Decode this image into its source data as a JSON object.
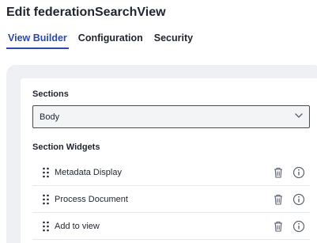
{
  "header": {
    "title": "Edit federationSearchView"
  },
  "tabs": [
    {
      "label": "View Builder",
      "active": true
    },
    {
      "label": "Configuration",
      "active": false
    },
    {
      "label": "Security",
      "active": false
    }
  ],
  "sections": {
    "label": "Sections",
    "selected": "Body"
  },
  "section_widgets": {
    "label": "Section Widgets",
    "items": [
      {
        "label": "Metadata Display"
      },
      {
        "label": "Process Document"
      },
      {
        "label": "Add to view"
      }
    ]
  },
  "colors": {
    "accent": "#2b4aa8",
    "panel": "#eef0f4",
    "text": "#1f2430",
    "icon": "#5b6270"
  }
}
